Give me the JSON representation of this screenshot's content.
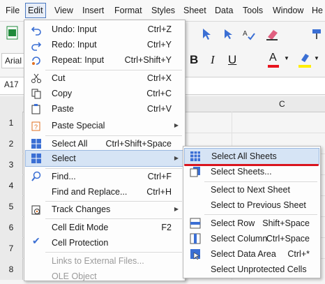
{
  "menubar": [
    "File",
    "Edit",
    "View",
    "Insert",
    "Format",
    "Styles",
    "Sheet",
    "Data",
    "Tools",
    "Window",
    "He"
  ],
  "font_name": "Arial",
  "cell_ref": "A17",
  "column_c": "C",
  "row_numbers": [
    "1",
    "2",
    "3",
    "4",
    "5",
    "6",
    "7",
    "8"
  ],
  "edit_menu": [
    {
      "label": "Undo: Input",
      "shortcut": "Ctrl+Z",
      "icon": "undo-icon"
    },
    {
      "label": "Redo: Input",
      "shortcut": "Ctrl+Y",
      "icon": "redo-icon"
    },
    {
      "label": "Repeat: Input",
      "shortcut": "Ctrl+Shift+Y",
      "icon": "repeat-icon"
    },
    {
      "label": "Cut",
      "shortcut": "Ctrl+X",
      "icon": "cut-icon"
    },
    {
      "label": "Copy",
      "shortcut": "Ctrl+C",
      "icon": "copy-icon"
    },
    {
      "label": "Paste",
      "shortcut": "Ctrl+V",
      "icon": "paste-icon"
    },
    {
      "label": "Paste Special",
      "shortcut": "",
      "icon": "paste-special-icon"
    },
    {
      "label": "Select All",
      "shortcut": "Ctrl+Shift+Space",
      "icon": "select-all-icon"
    },
    {
      "label": "Select",
      "shortcut": "",
      "icon": ""
    },
    {
      "label": "Find...",
      "shortcut": "Ctrl+F",
      "icon": "find-icon"
    },
    {
      "label": "Find and Replace...",
      "shortcut": "Ctrl+H",
      "icon": ""
    },
    {
      "label": "Track Changes",
      "shortcut": "",
      "icon": "track-changes-icon"
    },
    {
      "label": "Cell Edit Mode",
      "shortcut": "F2",
      "icon": ""
    },
    {
      "label": "Cell Protection",
      "shortcut": "",
      "icon": "check-icon"
    },
    {
      "label": "Links to External Files...",
      "shortcut": "",
      "icon": ""
    },
    {
      "label": "OLE Object",
      "shortcut": "",
      "icon": ""
    }
  ],
  "select_submenu": [
    {
      "label": "Select All Sheets",
      "shortcut": ""
    },
    {
      "label": "Select Sheets...",
      "shortcut": ""
    },
    {
      "label": "Select to Next Sheet",
      "shortcut": ""
    },
    {
      "label": "Select to Previous Sheet",
      "shortcut": ""
    },
    {
      "label": "Select Row",
      "shortcut": "Shift+Space"
    },
    {
      "label": "Select Column",
      "shortcut": "Ctrl+Space"
    },
    {
      "label": "Select Data Area",
      "shortcut": "Ctrl+*"
    },
    {
      "label": "Select Unprotected Cells",
      "shortcut": ""
    }
  ],
  "colors": {
    "accent": "#3b6fd4",
    "highlight": "#d6e4f5",
    "red_underline": "#d9141e",
    "font_color_bar": "#e8141e",
    "highlight_bar": "#ffee00"
  }
}
